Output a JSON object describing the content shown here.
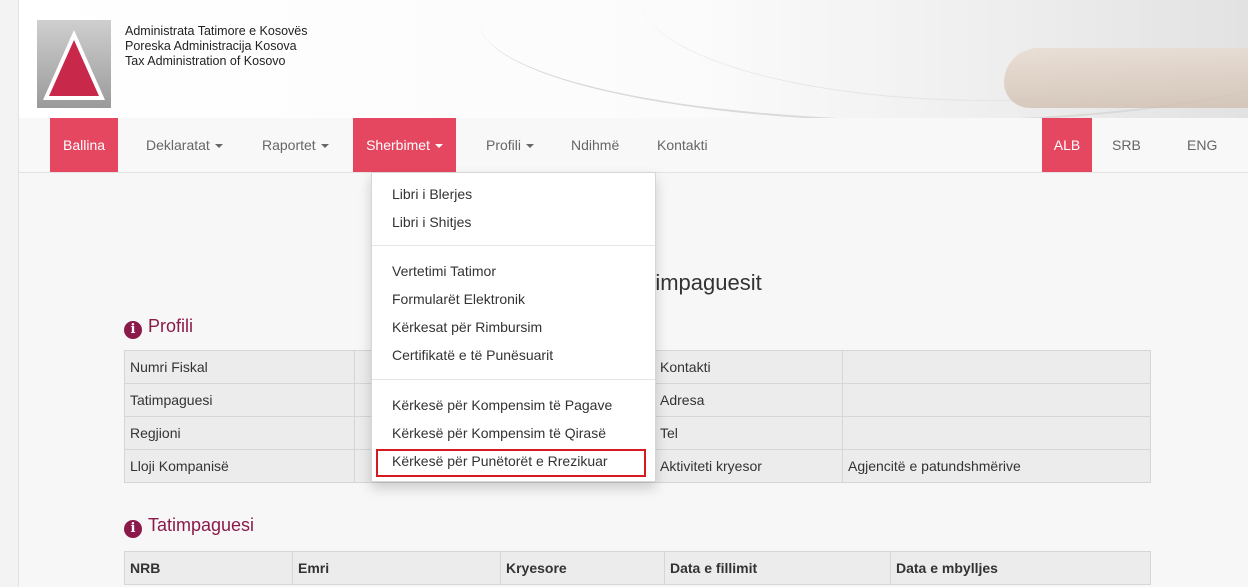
{
  "header": {
    "org_lines": [
      "Administrata Tatimore e Kosovës",
      "Poreska Administracija Kosova",
      "Tax Administration of Kosovo"
    ]
  },
  "nav": {
    "home": "Ballina",
    "declarations": "Deklaratat",
    "reports": "Raportet",
    "services": "Sherbimet",
    "profile": "Profili",
    "help": "Ndihmë",
    "contact": "Kontakti",
    "languages": [
      "ALB",
      "SRB",
      "ENG"
    ],
    "active_language": "ALB"
  },
  "services_menu": {
    "group1": [
      "Libri i Blerjes",
      "Libri i Shitjes"
    ],
    "group2": [
      "Vertetimi Tatimor",
      "Formularët Elektronik",
      "Kërkesat për Rimbursim",
      "Certifikatë e të Punësuarit"
    ],
    "group3": [
      "Kërkesë për Kompensim të Pagave",
      "Kërkesë për Kompensim të Qirasë",
      "Kërkesë për Punëtorët e Rrezikuar"
    ],
    "highlighted_item": "Kërkesë për Punëtorët e Rrezikuar"
  },
  "main": {
    "heading_partial": "atimpaguesit",
    "profile_section": {
      "title": "Profili",
      "left_labels": [
        "Numri Fiskal",
        "Tatimpaguesi",
        "Regjioni",
        "Lloji Kompanisë"
      ],
      "right_labels": [
        "Kontakti",
        "Adresa",
        "Tel",
        "Aktiviteti kryesor"
      ],
      "right_values": [
        "",
        "",
        "",
        "Agjencitë e patundshmërive"
      ]
    },
    "taxpayer_section": {
      "title": "Tatimpaguesi",
      "columns": [
        "NRB",
        "Emri",
        "Kryesore",
        "Data e fillimit",
        "Data e mbylljes"
      ]
    }
  },
  "colors": {
    "accent": "#e64760",
    "section_title": "#8b1a4a",
    "highlight_border": "#d71920"
  }
}
